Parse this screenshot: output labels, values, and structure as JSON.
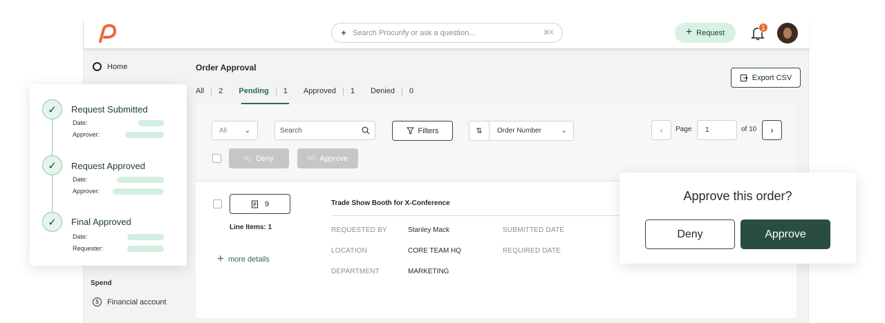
{
  "topbar": {
    "search_placeholder": "Search Procurify or ask a question...",
    "search_shortcut": "⌘K",
    "request_label": "Request",
    "notification_count": "1",
    "brand_color": "#e8693a"
  },
  "sidebar": {
    "home_label": "Home",
    "section_spend": "Spend",
    "financial_account_label": "Financial account"
  },
  "main": {
    "page_title": "Order Approval",
    "export_label": "Export CSV",
    "tabs": [
      {
        "label": "All",
        "count": "2"
      },
      {
        "label": "Pending",
        "count": "1"
      },
      {
        "label": "Approved",
        "count": "1"
      },
      {
        "label": "Denied",
        "count": "0"
      }
    ],
    "filter": {
      "select_value": "All",
      "search_placeholder": "Search",
      "filters_label": "Filters",
      "sort_value": "Order Number",
      "page_label": "Page",
      "page_value": "1",
      "page_total": "of 10",
      "deny_label": "Deny",
      "approve_label": "Approve"
    },
    "order": {
      "line_items_count": "9",
      "line_items_label": "Line Items: 1",
      "more_details": "more details",
      "title": "Trade Show Booth for X-Conference",
      "fields": {
        "requested_by_key": "REQUESTED BY",
        "requested_by_val": "Stanley Mack",
        "location_key": "LOCATION",
        "location_val": "CORE TEAM HQ",
        "department_key": "DEPARTMENT",
        "department_val": "MARKETING",
        "submitted_date_key": "SUBMITTED DATE",
        "required_date_key": "REQUIRED DATE"
      }
    }
  },
  "timeline": {
    "steps": [
      {
        "title": "Request Submitted",
        "k1": "Date:",
        "k2": "Approver:"
      },
      {
        "title": "Request Approved",
        "k1": "Date:",
        "k2": "Approver:"
      },
      {
        "title": "Final Approved",
        "k1": "Date:",
        "k2": "Requester:"
      }
    ]
  },
  "dialog": {
    "title": "Approve this order?",
    "deny_label": "Deny",
    "approve_label": "Approve"
  }
}
